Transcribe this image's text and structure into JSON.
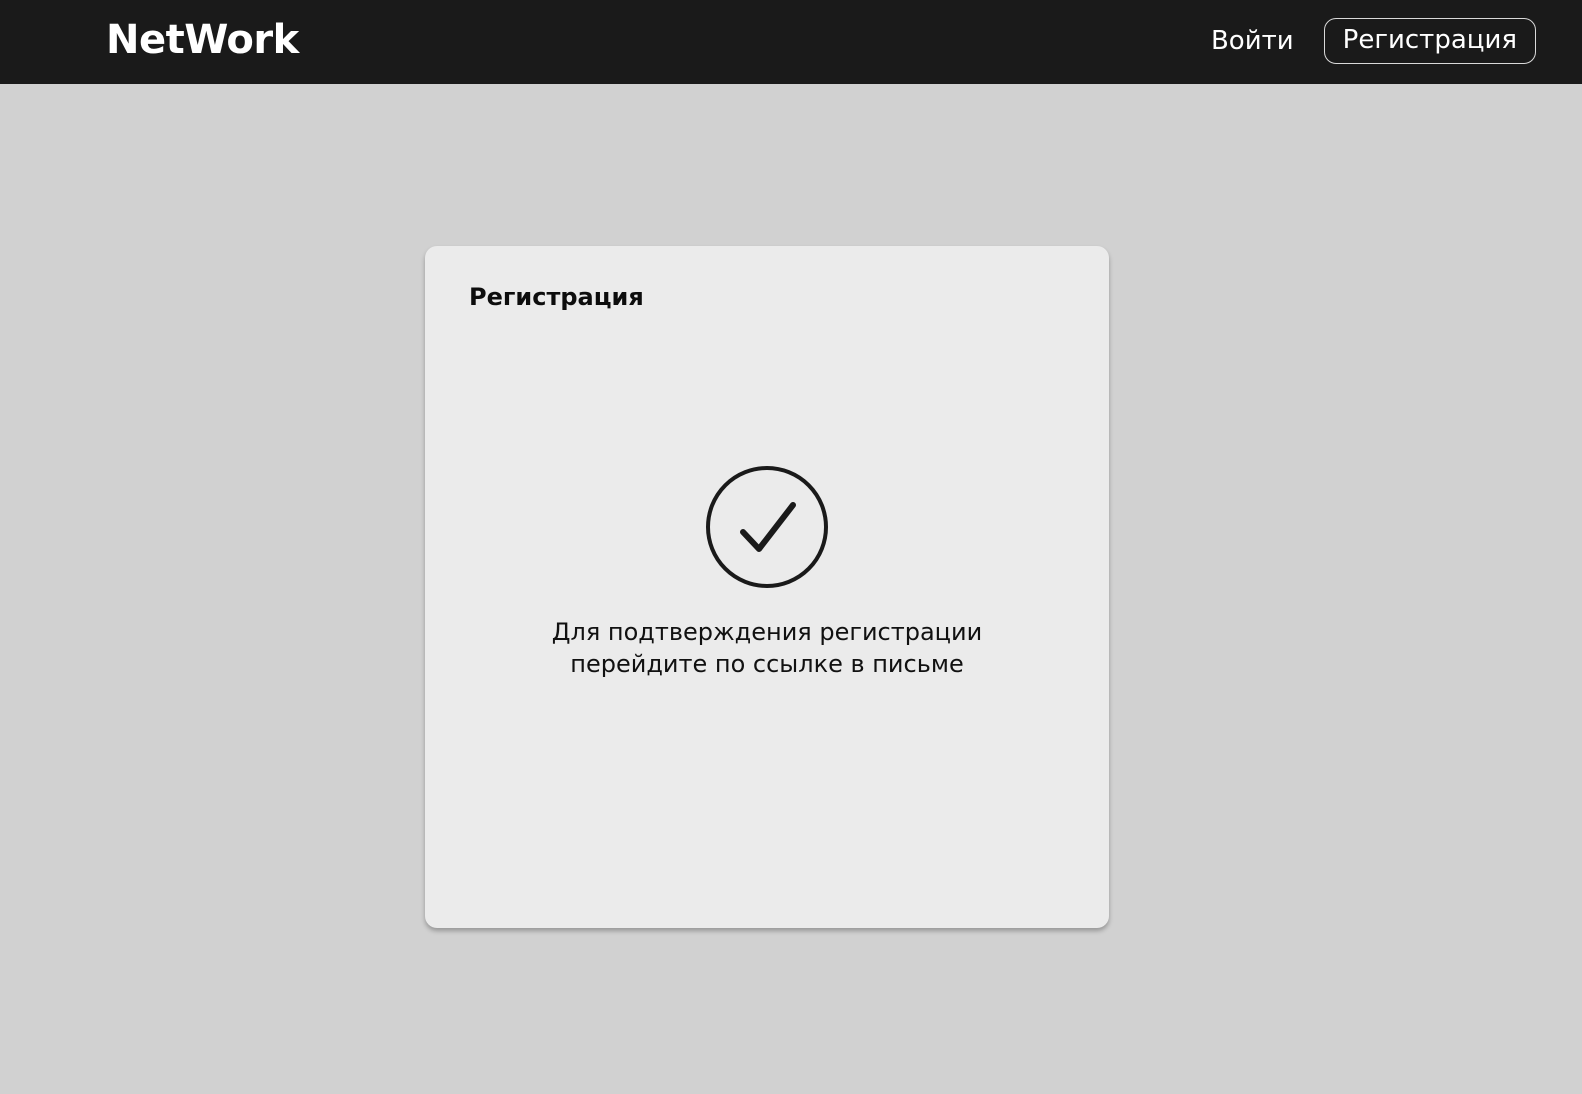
{
  "header": {
    "logo": "NetWork",
    "login_label": "Войти",
    "register_label": "Регистрация"
  },
  "card": {
    "title": "Регистрация",
    "icon": "check-circle-icon",
    "message_line1": "Для подтверждения регистрации",
    "message_line2": "перейдите по ссылке в письме"
  },
  "colors": {
    "header_bg": "#1a1a1a",
    "page_bg": "#d1d1d1",
    "card_bg": "#ebebeb",
    "text": "#111111"
  }
}
